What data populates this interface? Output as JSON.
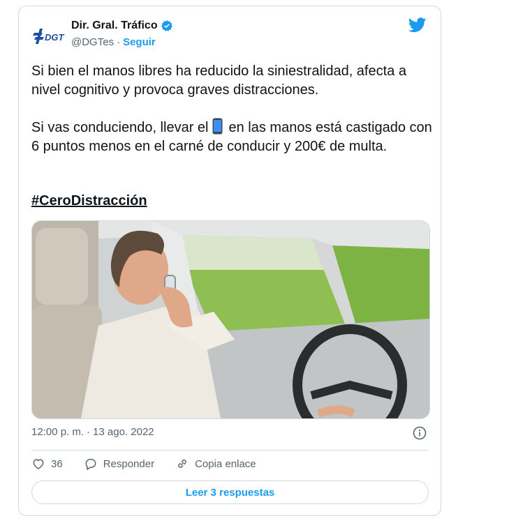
{
  "account": {
    "display_name": "Dir. Gral. Tráfico",
    "handle": "@DGTes",
    "separator": "·",
    "follow_label": "Seguir",
    "logo_text": "DGT",
    "verified_icon": "verified-badge-icon",
    "platform_icon": "twitter-bird-icon"
  },
  "tweet": {
    "paragraph1": "Si bien el manos libres ha reducido la siniestralidad, afecta a nivel cognitivo y provoca graves distracciones.",
    "paragraph2_before": "Si vas conduciendo, llevar el",
    "paragraph2_emoji": "mobile-phone-icon",
    "paragraph2_after": "en las manos está castigado con 6 puntos menos en el carné de conducir y 200€ de multa.",
    "hashtag": "#CeroDistracción"
  },
  "meta": {
    "time": "12:00 p. m.",
    "separator": "·",
    "date": "13 ago. 2022"
  },
  "actions": {
    "like_count": "36",
    "reply_label": "Responder",
    "copy_label": "Copia enlace"
  },
  "read_replies_label": "Leer 3 respuestas",
  "colors": {
    "accent": "#1d9bf0",
    "text": "#0f1419",
    "secondary": "#536471",
    "border": "#cfd9de"
  }
}
